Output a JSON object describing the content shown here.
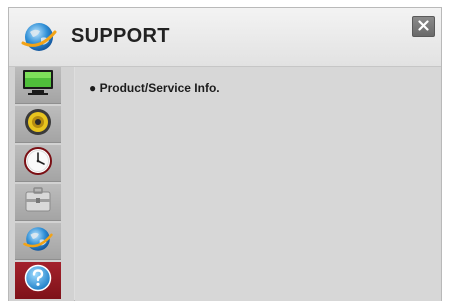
{
  "dialog": {
    "title": "SUPPORT",
    "title_icon": "globe-icon",
    "close_icon": "close-icon"
  },
  "sidebar": {
    "items": [
      {
        "name": "picture",
        "icon": "monitor-icon"
      },
      {
        "name": "audio",
        "icon": "speaker-icon"
      },
      {
        "name": "time",
        "icon": "clock-icon"
      },
      {
        "name": "setup",
        "icon": "toolbox-icon"
      },
      {
        "name": "network",
        "icon": "globe-icon"
      },
      {
        "name": "support",
        "icon": "help-icon",
        "selected": true
      }
    ]
  },
  "content": {
    "items": [
      {
        "label": "● Product/Service Info."
      }
    ]
  },
  "colors": {
    "selected": "#8f1a22",
    "panel": "#d7d7d7"
  }
}
